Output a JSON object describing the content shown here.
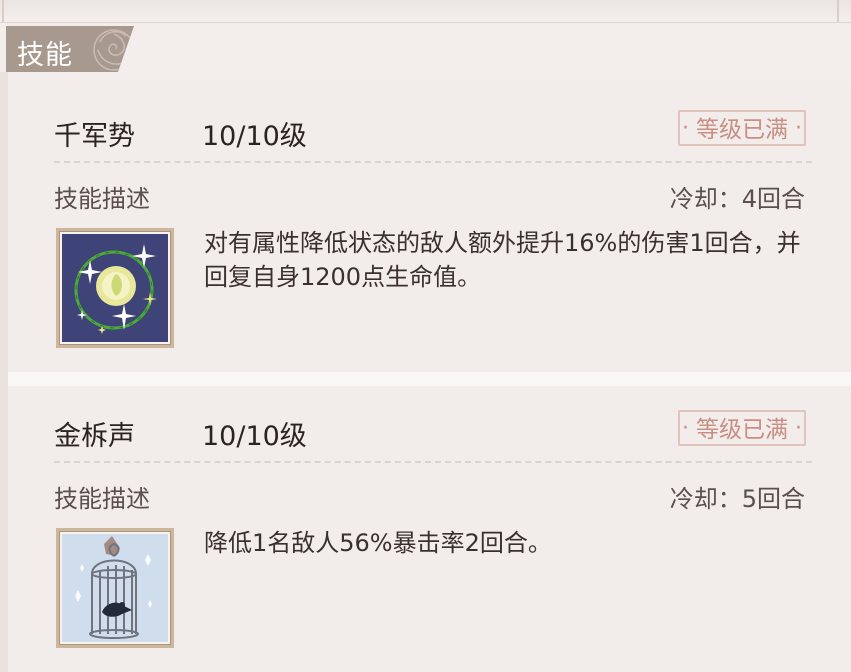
{
  "section": {
    "title": "技能"
  },
  "skills": [
    {
      "name": "千军势",
      "level": "10/10级",
      "badge": "等级已满",
      "desc_label": "技能描述",
      "cooldown": "冷却：4回合",
      "description": "对有属性降低状态的敌人额外提升16%的伤害1回合，并回复自身1200点生命值。",
      "icon": "sparkle-moon-icon"
    },
    {
      "name": "金柝声",
      "level": "10/10级",
      "badge": "等级已满",
      "desc_label": "技能描述",
      "cooldown": "冷却：5回合",
      "description": "降低1名敌人56%暴击率2回合。",
      "icon": "bird-cage-icon"
    }
  ],
  "colors": {
    "tab": "#a8998f",
    "badge": "#c88f84",
    "card": "#f2eceb"
  }
}
